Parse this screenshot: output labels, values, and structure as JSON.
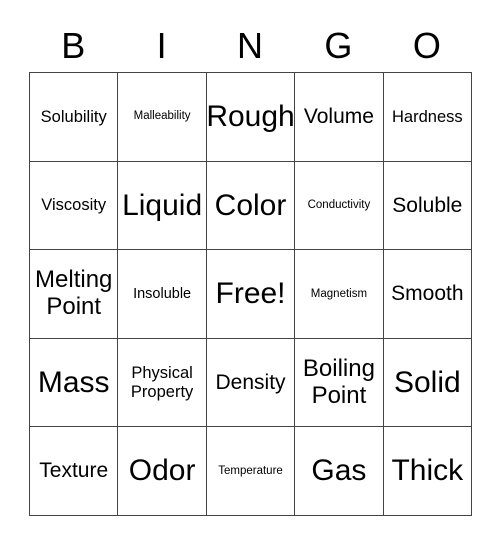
{
  "card": {
    "title": "BINGO",
    "headers": [
      "B",
      "I",
      "N",
      "G",
      "O"
    ],
    "free_space": "Free!",
    "rows": [
      [
        {
          "text": "Solubility",
          "size": "md"
        },
        {
          "text": "Malleability",
          "size": "xs"
        },
        {
          "text": "Rough",
          "size": "xxl"
        },
        {
          "text": "Volume",
          "size": "lg"
        },
        {
          "text": "Hardness",
          "size": "md"
        }
      ],
      [
        {
          "text": "Viscosity",
          "size": "md"
        },
        {
          "text": "Liquid",
          "size": "xxl"
        },
        {
          "text": "Color",
          "size": "xxl"
        },
        {
          "text": "Conductivity",
          "size": "xs"
        },
        {
          "text": "Soluble",
          "size": "lg"
        }
      ],
      [
        {
          "text": "Melting Point",
          "size": "xl"
        },
        {
          "text": "Insoluble",
          "size": "sm"
        },
        {
          "text": "Free!",
          "size": "xxl"
        },
        {
          "text": "Magnetism",
          "size": "xs"
        },
        {
          "text": "Smooth",
          "size": "lg"
        }
      ],
      [
        {
          "text": "Mass",
          "size": "xxl"
        },
        {
          "text": "Physical Property",
          "size": "md"
        },
        {
          "text": "Density",
          "size": "lg"
        },
        {
          "text": "Boiling Point",
          "size": "xl"
        },
        {
          "text": "Solid",
          "size": "xxl"
        }
      ],
      [
        {
          "text": "Texture",
          "size": "lg"
        },
        {
          "text": "Odor",
          "size": "xxl"
        },
        {
          "text": "Temperature",
          "size": "xs"
        },
        {
          "text": "Gas",
          "size": "xxl"
        },
        {
          "text": "Thick",
          "size": "xxl"
        }
      ]
    ]
  },
  "colors": {
    "border": "#444444",
    "text": "#000000",
    "background": "#ffffff"
  }
}
